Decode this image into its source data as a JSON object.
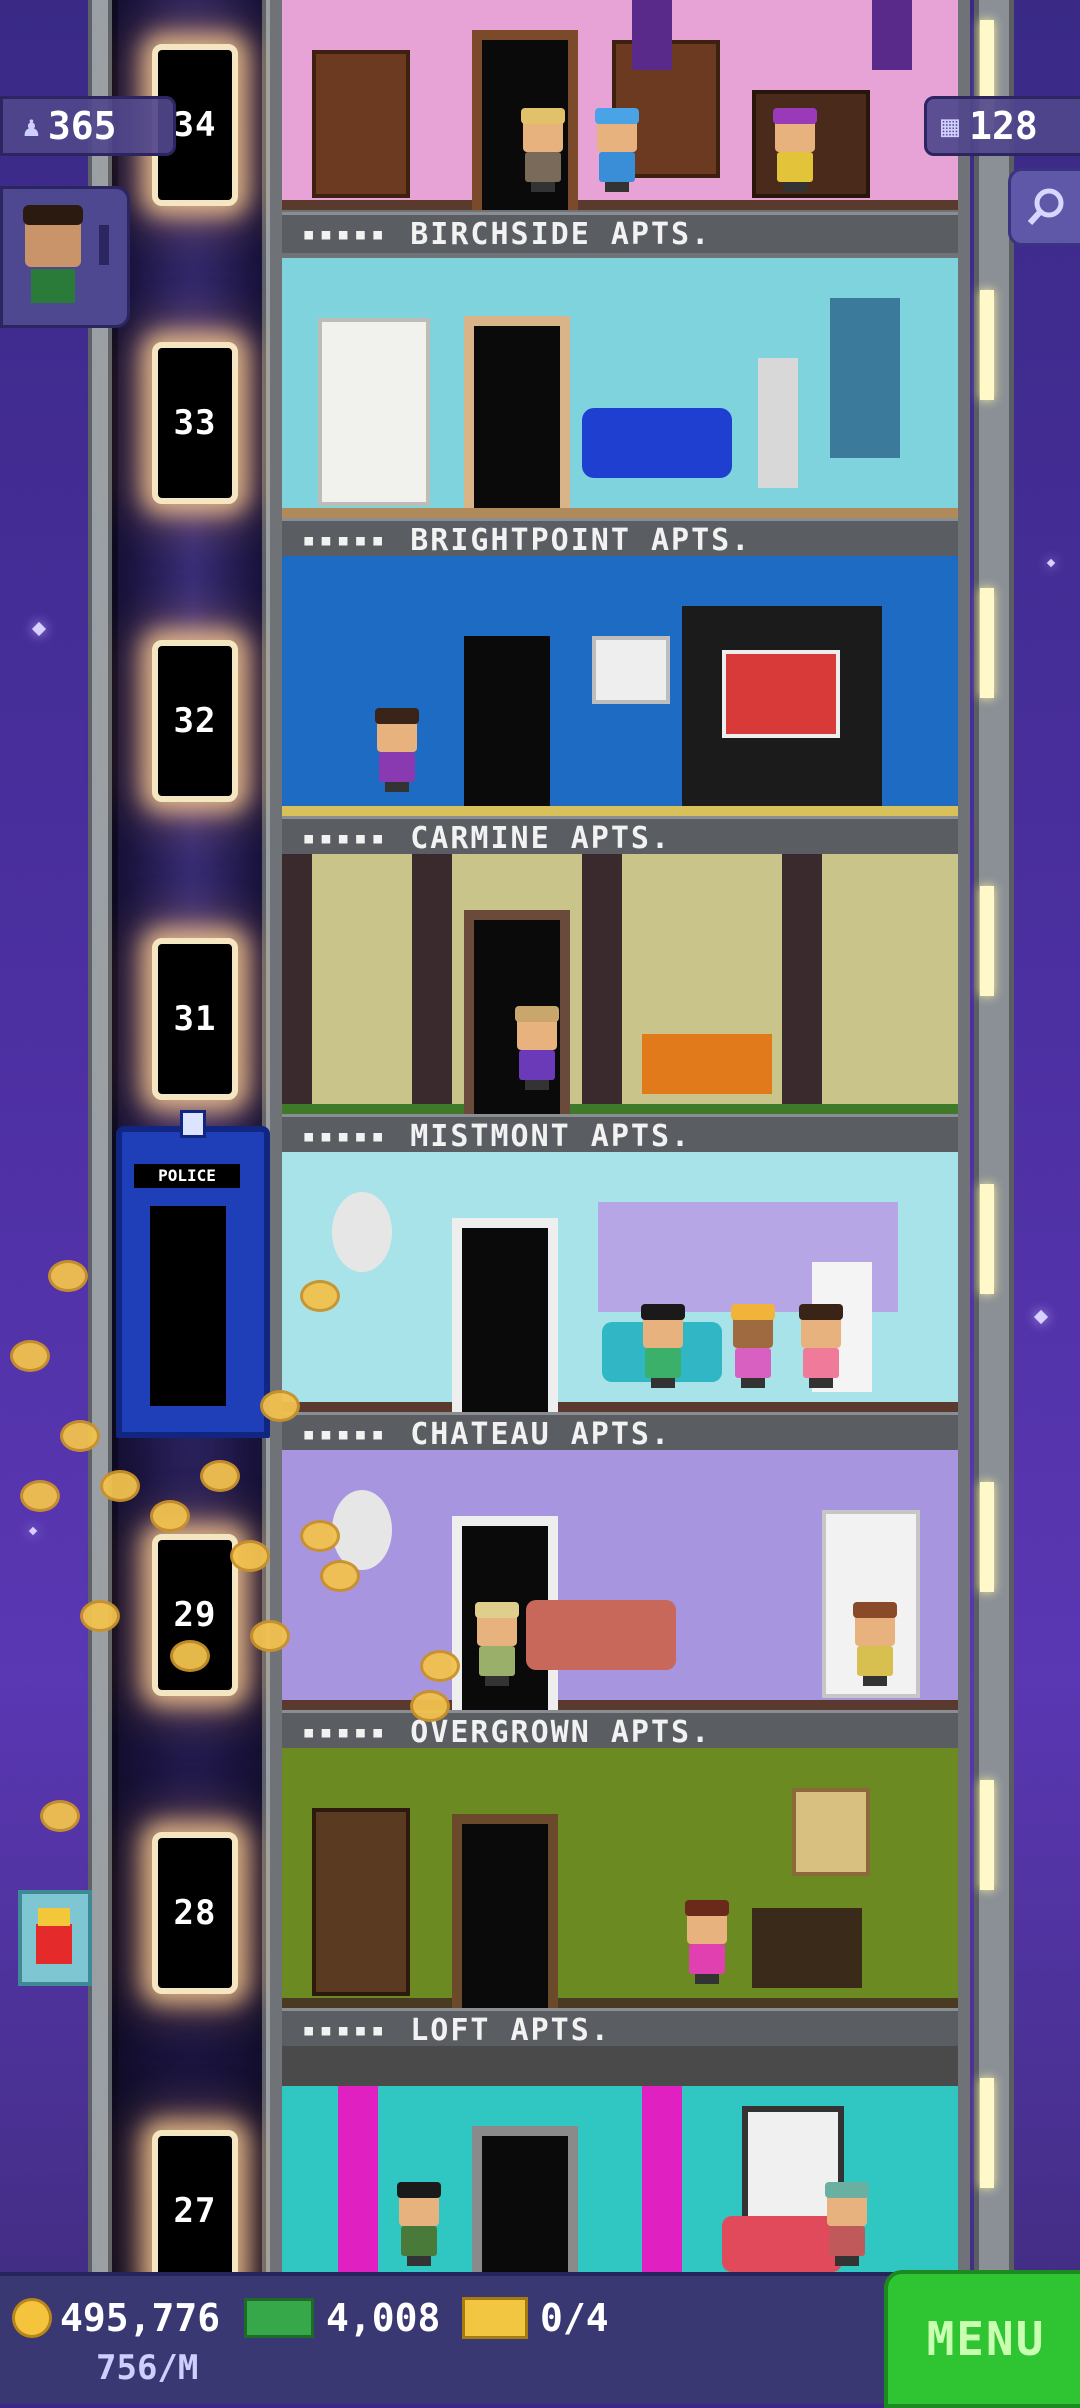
{
  "hud": {
    "population": "365",
    "floors": "128"
  },
  "elevator_floors": [
    "34",
    "33",
    "32",
    "31",
    "29",
    "28",
    "27"
  ],
  "police_box_sign": "POLICE",
  "floors": [
    {
      "name": "BIRCHSIDE APTS.",
      "wall": "#e7a3d6"
    },
    {
      "name": "BRIGHTPOINT APTS.",
      "wall": "#7fd3dc"
    },
    {
      "name": "CARMINE APTS.",
      "wall": "#1e6bc3"
    },
    {
      "name": "MISTMONT APTS.",
      "wall": "#c9c58a"
    },
    {
      "name": "CHATEAU APTS.",
      "wall": "#a9e3ea"
    },
    {
      "name": "OVERGROWN APTS.",
      "wall": "#a895df"
    },
    {
      "name": "LOFT APTS.",
      "wall": "#6b8a22"
    },
    {
      "name": "",
      "wall": "#30c7c2"
    }
  ],
  "bottom_bar": {
    "coins": "495,776",
    "rate": "756/M",
    "tower_bux": "4,008",
    "golden_tickets": "0/4",
    "menu_label": "MENU"
  },
  "colors": {
    "sky": "#4b2fa0",
    "menu_green": "#2fc432",
    "coin_gold": "#f4c53c"
  },
  "icons": [
    "population-icon",
    "floors-icon",
    "search-icon",
    "coin-icon",
    "bux-icon",
    "ticket-icon",
    "fries-icon"
  ]
}
